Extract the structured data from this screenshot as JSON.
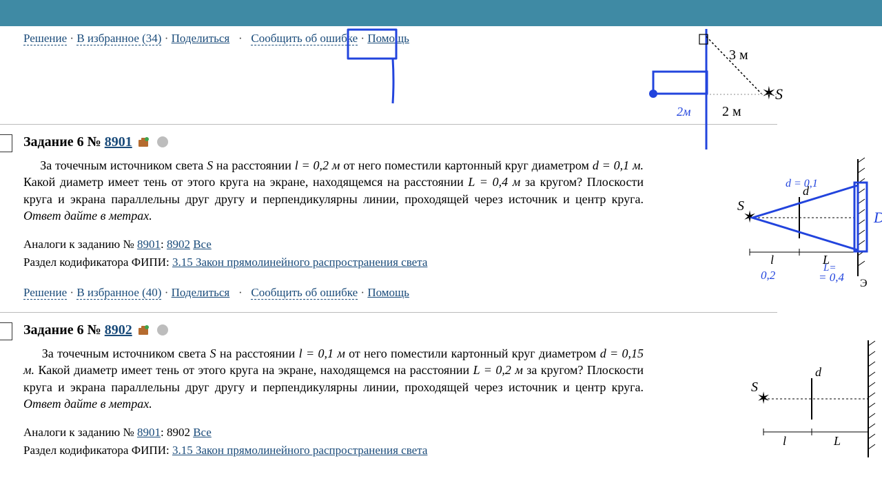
{
  "actions1": {
    "solution": "Решение",
    "fav": "В избранное (34)",
    "share": "Поделиться",
    "bug": "Сообщить об ошибке",
    "help": "Помощь"
  },
  "task6_8901": {
    "label": "Задание 6",
    "num_prefix": "№",
    "id": "8901",
    "text_pre": "За точечным источником света ",
    "S": "S",
    "text_at_dist": " на расстоянии ",
    "l_eq": "l = 0,2 м",
    "text_post1": " от него поместили картонный круг диаметром ",
    "d_eq": "d = 0,1 м.",
    "text_q": " Какой диаметр имеет тень от этого круга на экране, находящемся на расстоянии ",
    "L_eq": "L = 0,4 м",
    "text_q2": " за кругом? Плоскости круга и экрана параллельны друг другу и перпендикулярны линии, проходящей через источник и центр круга. ",
    "answer_hint": "Ответ дайте в метрах.",
    "analogs_label": "Аналоги к заданию №",
    "analog1": "8901",
    "analog2": "8902",
    "analogs_all": "Все",
    "kod_label": "Раздел кодификатора ФИПИ:",
    "kod_link": "3.15 Закон прямолинейного распространения света",
    "actions": {
      "solution": "Решение",
      "fav": "В избранное (40)",
      "share": "Поделиться",
      "bug": "Сообщить об ошибке",
      "help": "Помощь"
    }
  },
  "task6_8902": {
    "label": "Задание 6",
    "num_prefix": "№",
    "id": "8902",
    "text_pre": "За точечным источником света ",
    "S": "S",
    "text_at_dist": " на расстоянии ",
    "l_eq": "l = 0,1 м",
    "text_post1": " от него поместили картонный круг диаметром ",
    "d_eq": "d = 0,15 м.",
    "text_q": " Какой диаметр имеет тень от этого круга на экране, находящемся на расстоянии ",
    "L_eq": "L = 0,2 м",
    "text_q2": " за кругом? Плоскости круга и экрана параллельны друг другу и перпендикулярны линии, проходящей через источник и центр круга. ",
    "answer_hint": "Ответ дайте в метрах.",
    "analogs_label": "Аналоги к заданию №",
    "analog1": "8901",
    "analog2": "8902",
    "analogs_all": "Все",
    "kod_label": "Раздел кодификатора ФИПИ:",
    "kod_link": "3.15 Закон прямолинейного распространения света"
  },
  "fig1": {
    "dist_top": "3 м",
    "dist_bot": "2 м",
    "S": "S",
    "hand_2m": "2м"
  },
  "fig2": {
    "S": "S",
    "l": "l",
    "L": "L",
    "d": "d",
    "screen": "Э",
    "hand_d": "d = 0,1",
    "hand_D": "D",
    "hand_l": "0,2",
    "hand_L": "= 0,4",
    "hand_Leq": "L="
  },
  "fig3": {
    "S": "S",
    "l": "l",
    "L": "L",
    "d": "d"
  }
}
